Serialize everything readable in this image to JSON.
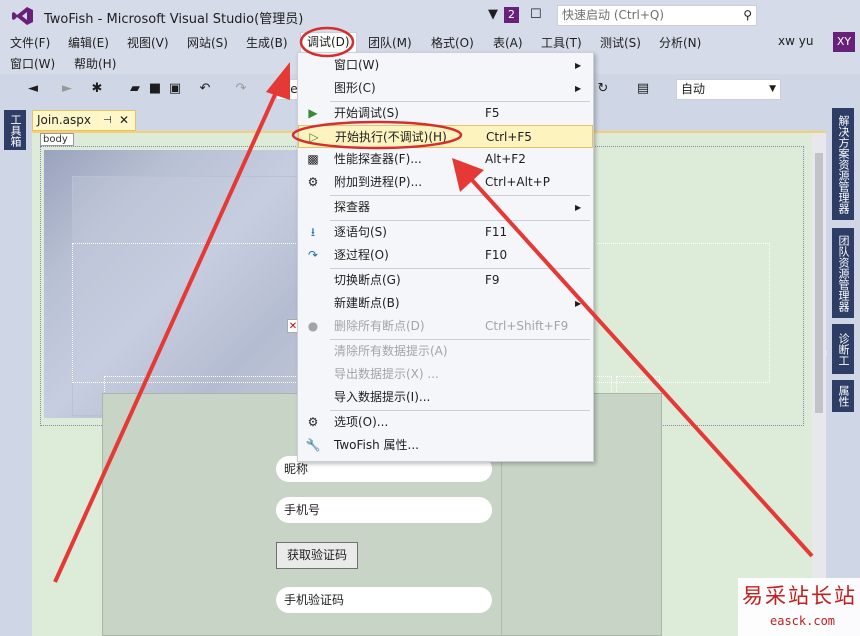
{
  "window": {
    "title": "TwoFish - Microsoft Visual Studio(管理员)",
    "notification_count": "2",
    "quick_launch_placeholder": "快速启动 (Ctrl+Q)",
    "user_name": "xw yu",
    "user_initials": "XY"
  },
  "menubar": {
    "items": [
      {
        "label": "文件(F)"
      },
      {
        "label": "编辑(E)"
      },
      {
        "label": "视图(V)"
      },
      {
        "label": "网站(S)"
      },
      {
        "label": "生成(B)"
      },
      {
        "label": "调试(D)"
      },
      {
        "label": "团队(M)"
      },
      {
        "label": "格式(O)"
      },
      {
        "label": "表(A)"
      },
      {
        "label": "工具(T)"
      },
      {
        "label": "测试(S)"
      },
      {
        "label": "分析(N)"
      }
    ],
    "row2": [
      {
        "label": "窗口(W)"
      },
      {
        "label": "帮助(H)"
      }
    ],
    "open_menu": "调试(D)"
  },
  "toolbar": {
    "config_combo": "De",
    "target_combo": "自动"
  },
  "left_sidebar": {
    "toolbox_label": "工具箱"
  },
  "right_sidebar": {
    "tabs": [
      "解决方案资源管理器",
      "团队资源管理器",
      "诊断工具",
      "属性"
    ]
  },
  "document": {
    "tab_name": "Join.aspx",
    "body_tag": "body",
    "fields": {
      "nickname": "昵称",
      "phone": "手机号",
      "get_code": "获取验证码",
      "code": "手机验证码"
    }
  },
  "debug_menu": {
    "items": [
      {
        "label": "窗口(W)",
        "shortcut": "",
        "submenu": true,
        "icon": "none"
      },
      {
        "label": "图形(C)",
        "shortcut": "",
        "submenu": true,
        "icon": "none"
      },
      {
        "label": "开始调试(S)",
        "shortcut": "F5",
        "icon": "play-icon"
      },
      {
        "label": "开始执行(不调试)(H)",
        "shortcut": "Ctrl+F5",
        "icon": "play-outline-icon",
        "highlighted": true
      },
      {
        "label": "性能探查器(F)...",
        "shortcut": "Alt+F2",
        "icon": "profiler-icon"
      },
      {
        "label": "附加到进程(P)...",
        "shortcut": "Ctrl+Alt+P",
        "icon": "attach-icon"
      },
      {
        "label": "探查器",
        "shortcut": "",
        "submenu": true,
        "icon": "none"
      },
      {
        "label": "逐语句(S)",
        "shortcut": "F11",
        "icon": "step-into-icon"
      },
      {
        "label": "逐过程(O)",
        "shortcut": "F10",
        "icon": "step-over-icon"
      },
      {
        "label": "切换断点(G)",
        "shortcut": "F9",
        "icon": "none"
      },
      {
        "label": "新建断点(B)",
        "shortcut": "",
        "submenu": true,
        "icon": "none"
      },
      {
        "label": "删除所有断点(D)",
        "shortcut": "Ctrl+Shift+F9",
        "icon": "delete-breakpoints-icon",
        "disabled": true
      },
      {
        "label": "清除所有数据提示(A)",
        "shortcut": "",
        "disabled": true
      },
      {
        "label": "导出数据提示(X) ...",
        "shortcut": "",
        "disabled": true
      },
      {
        "label": "导入数据提示(I)...",
        "shortcut": ""
      },
      {
        "label": "选项(O)...",
        "shortcut": "",
        "icon": "gear-icon"
      },
      {
        "label": "TwoFish 属性...",
        "shortcut": "",
        "icon": "wrench-icon"
      }
    ]
  },
  "watermark": {
    "text_cn": "易采站长站",
    "text_en": "easck.com"
  },
  "colors": {
    "accent": "#68217a",
    "annotation": "#e53935",
    "highlight": "#fdf3bf"
  }
}
